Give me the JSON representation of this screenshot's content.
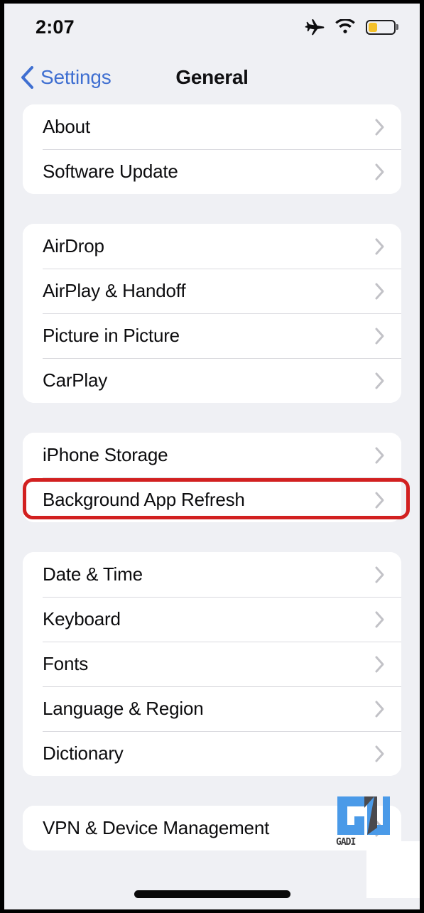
{
  "status_bar": {
    "time": "2:07",
    "icons": [
      "airplane-mode-icon",
      "wifi-icon",
      "battery-icon"
    ],
    "battery_level_percent": 35,
    "battery_color": "#f3c02a"
  },
  "nav": {
    "back_label": "Settings",
    "back_icon": "chevron-left-icon",
    "title": "General",
    "accent_color": "#3f6fd1"
  },
  "groups": [
    {
      "rows": [
        {
          "label": "About",
          "accessory": "chevron-right-icon"
        },
        {
          "label": "Software Update",
          "accessory": "chevron-right-icon"
        }
      ]
    },
    {
      "rows": [
        {
          "label": "AirDrop",
          "accessory": "chevron-right-icon"
        },
        {
          "label": "AirPlay & Handoff",
          "accessory": "chevron-right-icon"
        },
        {
          "label": "Picture in Picture",
          "accessory": "chevron-right-icon"
        },
        {
          "label": "CarPlay",
          "accessory": "chevron-right-icon"
        }
      ]
    },
    {
      "rows": [
        {
          "label": "iPhone Storage",
          "accessory": "chevron-right-icon",
          "highlighted": true
        },
        {
          "label": "Background App Refresh",
          "accessory": "chevron-right-icon"
        }
      ]
    },
    {
      "rows": [
        {
          "label": "Date & Time",
          "accessory": "chevron-right-icon"
        },
        {
          "label": "Keyboard",
          "accessory": "chevron-right-icon"
        },
        {
          "label": "Fonts",
          "accessory": "chevron-right-icon"
        },
        {
          "label": "Language & Region",
          "accessory": "chevron-right-icon"
        },
        {
          "label": "Dictionary",
          "accessory": "chevron-right-icon"
        }
      ]
    },
    {
      "rows": [
        {
          "label": "VPN & Device Management",
          "accessory": "chevron-right-icon"
        }
      ]
    }
  ],
  "annotation": {
    "target_label": "iPhone Storage",
    "color": "#d22020"
  },
  "watermark": {
    "text": "GADI",
    "primary_color": "#4a9ae8",
    "secondary_color": "#4a4a4e"
  }
}
